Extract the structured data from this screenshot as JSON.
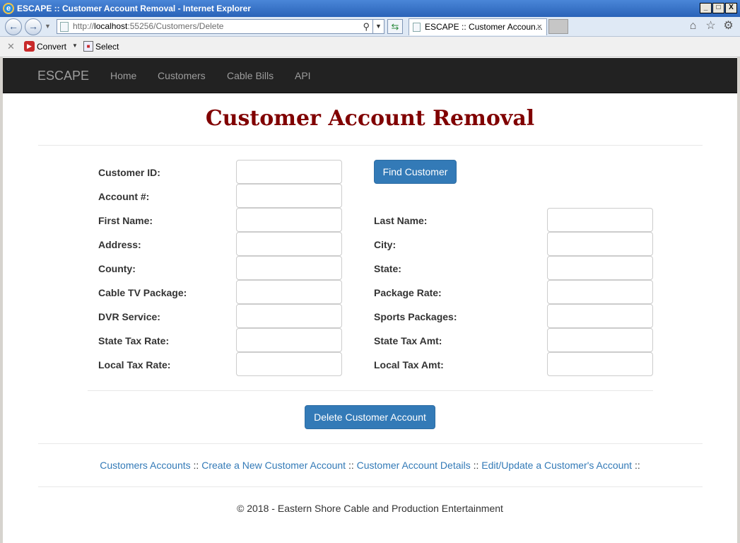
{
  "window": {
    "title": "ESCAPE :: Customer Account Removal - Internet Explorer",
    "min_label": "_",
    "max_label": "□",
    "close_label": "X"
  },
  "address_bar": {
    "url_prefix": "http://",
    "url_host": "localhost",
    "url_rest": ":55256/Customers/Delete"
  },
  "tab": {
    "label": "ESCAPE :: Customer Accoun...",
    "close": "×"
  },
  "command_bar": {
    "convert_label": "Convert",
    "select_label": "Select"
  },
  "navbar": {
    "brand": "ESCAPE",
    "links": [
      "Home",
      "Customers",
      "Cable Bills",
      "API"
    ]
  },
  "page": {
    "title": "Customer Account Removal"
  },
  "form": {
    "customer_id_label": "Customer ID:",
    "account_label": "Account #:",
    "find_button": "Find Customer",
    "left_fields": [
      "First Name:",
      "Address:",
      "County:",
      "Cable TV Package:",
      "DVR Service:",
      "State Tax Rate:",
      "Local Tax Rate:"
    ],
    "right_fields": [
      "Last Name:",
      "City:",
      "State:",
      "Package Rate:",
      "Sports Packages:",
      "State Tax Amt:",
      "Local Tax Amt:"
    ],
    "delete_button": "Delete Customer Account"
  },
  "footer_links": {
    "items": [
      "Customers Accounts",
      "Create a New Customer Account",
      "Customer Account Details",
      "Edit/Update a Customer's Account"
    ],
    "separator": " :: ",
    "trailing": " ::"
  },
  "footer": {
    "copyright": "© 2018 - Eastern Shore Cable and Production Entertainment"
  }
}
